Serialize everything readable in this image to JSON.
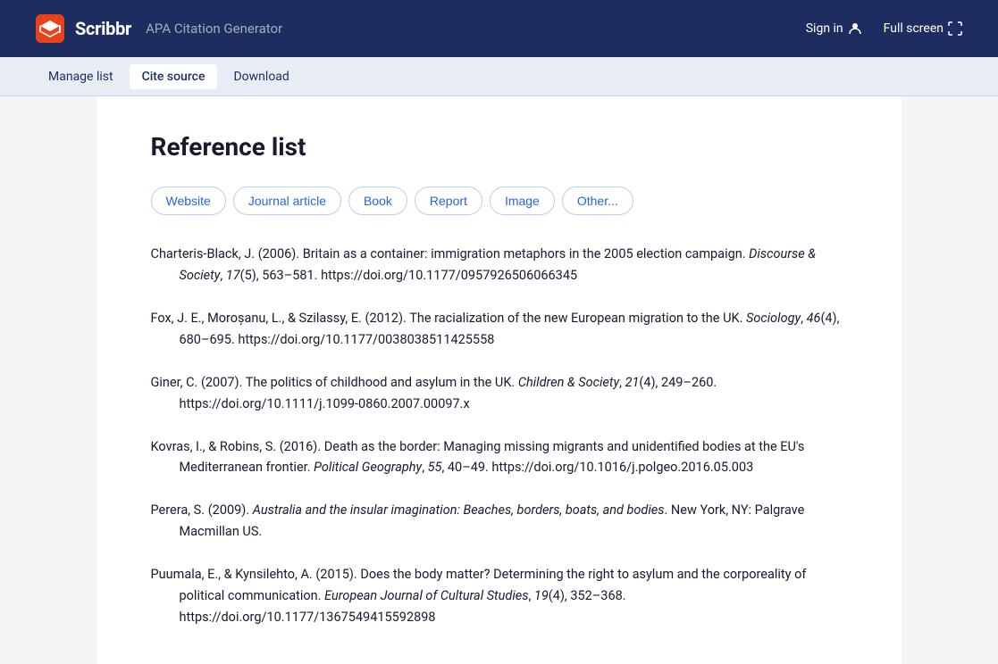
{
  "header": {
    "logo_text": "Scribbr",
    "app_title": "APA Citation Generator",
    "sign_in_label": "Sign in",
    "fullscreen_label": "Full screen"
  },
  "toolbar": {
    "items": [
      {
        "id": "manage-list",
        "label": "Manage list"
      },
      {
        "id": "cite-source",
        "label": "Cite source"
      },
      {
        "id": "download",
        "label": "Download"
      }
    ]
  },
  "main": {
    "page_title": "Reference list",
    "source_types": [
      "Website",
      "Journal article",
      "Book",
      "Report",
      "Image",
      "Other..."
    ],
    "references": [
      {
        "text": "Charteris-Black, J. (2006). Britain as a container: immigration metaphors in the 2005 election campaign.",
        "journal": "Discourse & Society",
        "volume_issue": ", 17(5), 563–581.",
        "doi": "https://doi.org/10.1177/0957926506066345"
      },
      {
        "text": "Fox, J. E., Moroșanu, L., & Szilassy, E. (2012). The racialization of the new European migration to the UK.",
        "journal": "Sociology",
        "volume_issue": ", 46(4), 680–695.",
        "doi": "https://doi.org/10.1177/0038038511425558"
      },
      {
        "text": "Giner, C. (2007). The politics of childhood and asylum in the UK.",
        "journal": "Children & Society",
        "volume_issue": ", 21(4), 249–260.",
        "doi": "https://doi.org/10.1111/j.1099-0860.2007.00097.x"
      },
      {
        "text": "Kovras, I., & Robins, S. (2016). Death as the border: Managing missing migrants and unidentified bodies at the EU's Mediterranean frontier.",
        "journal": "Political Geography",
        "volume_issue": ", 55, 40–49.",
        "doi": "https://doi.org/10.1016/j.polgeo.2016.05.003"
      },
      {
        "text": "Perera, S. (2009).",
        "journal": "Australia and the insular imagination: Beaches, borders, boats, and bodies",
        "volume_issue": ". New York, NY: Palgrave Macmillan US.",
        "doi": ""
      },
      {
        "text": "Puumala, E., & Kynsilehto, A. (2015). Does the body matter? Determining the right to asylum and the corporeality of political communication.",
        "journal": "European Journal of Cultural Studies",
        "volume_issue": ", 19(4), 352–368.",
        "doi": "https://doi.org/10.1177/1367549415592898"
      }
    ]
  }
}
